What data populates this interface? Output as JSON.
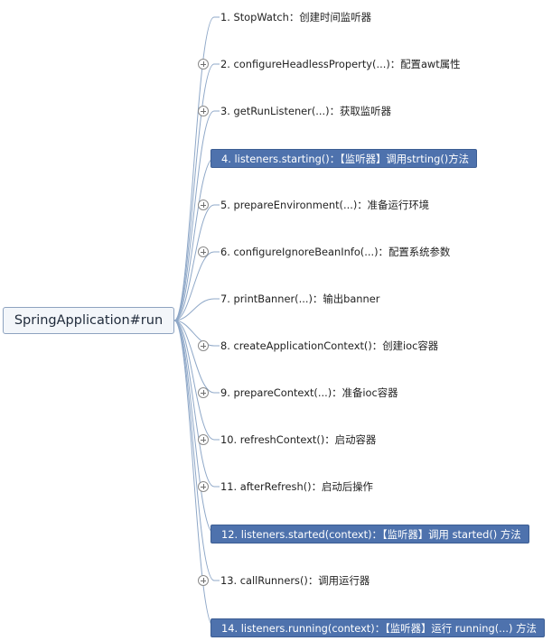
{
  "root": {
    "label": "SpringApplication#run"
  },
  "steps": [
    {
      "label": "1. StopWatch：创建时间监听器",
      "highlight": false,
      "expandable": false
    },
    {
      "label": "2. configureHeadlessProperty(...)：配置awt属性",
      "highlight": false,
      "expandable": true
    },
    {
      "label": "3. getRunListener(...)：获取监听器",
      "highlight": false,
      "expandable": true
    },
    {
      "label": "4. listeners.starting()：【监听器】调用strting()方法",
      "highlight": true,
      "expandable": false
    },
    {
      "label": "5. prepareEnvironment(...)：准备运行环境",
      "highlight": false,
      "expandable": true
    },
    {
      "label": "6. configureIgnoreBeanInfo(...)：配置系统参数",
      "highlight": false,
      "expandable": true
    },
    {
      "label": "7. printBanner(...)：输出banner",
      "highlight": false,
      "expandable": false
    },
    {
      "label": "8. createApplicationContext()：创建ioc容器",
      "highlight": false,
      "expandable": true
    },
    {
      "label": "9. prepareContext(...)：准备ioc容器",
      "highlight": false,
      "expandable": true
    },
    {
      "label": "10. refreshContext()：启动容器",
      "highlight": false,
      "expandable": true
    },
    {
      "label": "11. afterRefresh()：启动后操作",
      "highlight": false,
      "expandable": true
    },
    {
      "label": "12. listeners.started(context)：【监听器】调用 started() 方法",
      "highlight": true,
      "expandable": false
    },
    {
      "label": "13. callRunners()：调用运行器",
      "highlight": false,
      "expandable": true
    },
    {
      "label": "14. listeners.running(context)：【监听器】运行 running(...) 方法",
      "highlight": true,
      "expandable": false
    }
  ],
  "colors": {
    "highlight_fill": "#4e72ad",
    "connector": "#8fa8c8"
  }
}
